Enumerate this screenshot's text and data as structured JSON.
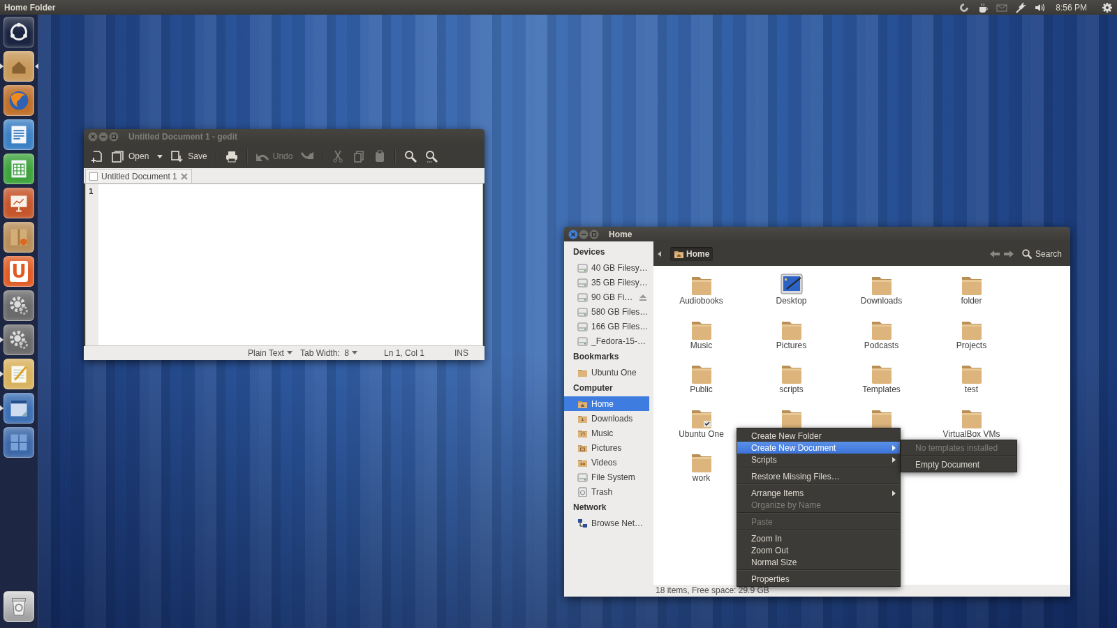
{
  "top_panel": {
    "title": "Home Folder",
    "clock": "8:56 PM"
  },
  "launcher": {
    "items": [
      {
        "kind": "dash",
        "running": false,
        "focused": false
      },
      {
        "kind": "home",
        "running": true,
        "focused": true
      },
      {
        "kind": "browser",
        "running": false,
        "focused": false
      },
      {
        "kind": "writer",
        "running": false,
        "focused": false
      },
      {
        "kind": "calc",
        "running": false,
        "focused": false
      },
      {
        "kind": "impress",
        "running": false,
        "focused": false
      },
      {
        "kind": "package",
        "running": false,
        "focused": false
      },
      {
        "kind": "letter",
        "label": "U",
        "running": false,
        "focused": false
      },
      {
        "kind": "gears",
        "running": false,
        "focused": false
      },
      {
        "kind": "gears",
        "running": true,
        "focused": false
      },
      {
        "kind": "editor",
        "running": true,
        "focused": false
      },
      {
        "kind": "window",
        "running": true,
        "focused": false
      },
      {
        "kind": "workspaces",
        "running": false,
        "focused": false
      }
    ]
  },
  "gedit": {
    "title": "Untitled Document 1 - gedit",
    "toolbar": [
      {
        "kind": "new",
        "disabled": false
      },
      {
        "kind": "open",
        "label": "Open",
        "disabled": false
      },
      {
        "kind": "dropdown",
        "disabled": false
      },
      {
        "kind": "save",
        "label": "Save",
        "disabled": false
      },
      {
        "kind": "separator"
      },
      {
        "kind": "print",
        "disabled": false
      },
      {
        "kind": "separator"
      },
      {
        "kind": "undo",
        "label": "Undo",
        "disabled": true
      },
      {
        "kind": "redo",
        "disabled": true
      },
      {
        "kind": "separator"
      },
      {
        "kind": "cut",
        "disabled": true
      },
      {
        "kind": "copy",
        "disabled": true
      },
      {
        "kind": "paste",
        "disabled": true
      },
      {
        "kind": "separator"
      },
      {
        "kind": "find",
        "disabled": false
      },
      {
        "kind": "replace",
        "disabled": false
      }
    ],
    "tabs": [
      {
        "label": "Untitled Document 1",
        "selected": true
      }
    ],
    "line_numbers": [
      "1"
    ],
    "status": [
      {
        "kind": "dropdown",
        "label": "Plain Text"
      },
      {
        "kind": "dropdown",
        "label": "Tab Width:  8"
      },
      {
        "kind": "text",
        "label": "Ln 1, Col 1"
      },
      {
        "kind": "text",
        "label": "INS"
      }
    ]
  },
  "files": {
    "title": "Home",
    "sidebar": [
      {
        "heading": "Devices",
        "items": [
          {
            "label": "40 GB Filesy…",
            "kind": "drive",
            "selected": false,
            "eject": false
          },
          {
            "label": "35 GB Filesy…",
            "kind": "drive",
            "selected": false,
            "eject": false
          },
          {
            "label": "90 GB Fi…",
            "kind": "drive",
            "selected": false,
            "eject": true
          },
          {
            "label": "580 GB Files…",
            "kind": "drive",
            "selected": false,
            "eject": false
          },
          {
            "label": "166 GB Files…",
            "kind": "drive",
            "selected": false,
            "eject": false
          },
          {
            "label": "_Fedora-15-…",
            "kind": "drive",
            "selected": false,
            "eject": false
          }
        ]
      },
      {
        "heading": "Bookmarks",
        "items": [
          {
            "label": "Ubuntu One",
            "kind": "folder",
            "selected": false,
            "eject": false
          }
        ]
      },
      {
        "heading": "Computer",
        "items": [
          {
            "label": "Home",
            "kind": "home",
            "selected": true,
            "eject": false
          },
          {
            "label": "Downloads",
            "kind": "downloads",
            "selected": false,
            "eject": false
          },
          {
            "label": "Music",
            "kind": "music",
            "selected": false,
            "eject": false
          },
          {
            "label": "Pictures",
            "kind": "pictures",
            "selected": false,
            "eject": false
          },
          {
            "label": "Videos",
            "kind": "videos",
            "selected": false,
            "eject": false
          },
          {
            "label": "File System",
            "kind": "drive",
            "selected": false,
            "eject": false
          },
          {
            "label": "Trash",
            "kind": "trash",
            "selected": false,
            "eject": false
          }
        ]
      },
      {
        "heading": "Network",
        "items": [
          {
            "label": "Browse Net…",
            "kind": "network",
            "selected": false,
            "eject": false
          }
        ]
      }
    ],
    "path": [
      {
        "label": "Home",
        "selected": true
      }
    ],
    "search": "Search",
    "items": [
      {
        "label": "Audiobooks",
        "kind": "folder"
      },
      {
        "label": "Desktop",
        "kind": "desktop"
      },
      {
        "label": "Downloads",
        "kind": "folder"
      },
      {
        "label": "folder",
        "kind": "folder"
      },
      {
        "label": "Music",
        "kind": "folder"
      },
      {
        "label": "Pictures",
        "kind": "folder"
      },
      {
        "label": "Podcasts",
        "kind": "folder"
      },
      {
        "label": "Projects",
        "kind": "folder"
      },
      {
        "label": "Public",
        "kind": "folder"
      },
      {
        "label": "scripts",
        "kind": "folder"
      },
      {
        "label": "Templates",
        "kind": "folder"
      },
      {
        "label": "test",
        "kind": "folder"
      },
      {
        "label": "Ubuntu One",
        "kind": "synced"
      },
      {
        "kind": "folder"
      },
      {
        "kind": "folder"
      },
      {
        "label": "VirtualBox VMs",
        "kind": "folder"
      },
      {
        "label": "work",
        "kind": "folder"
      }
    ],
    "status": "18 items, Free space: 29.9 GB",
    "context_menu": [
      {
        "kind": "item",
        "label": "Create New Folder",
        "selected": false,
        "disabled": false
      },
      {
        "kind": "submenu",
        "label": "Create New Document",
        "selected": true,
        "disabled": false,
        "children": [
          {
            "kind": "item",
            "label": "No templates installed",
            "selected": false,
            "disabled": true
          },
          {
            "kind": "separator"
          },
          {
            "kind": "item",
            "label": "Empty Document",
            "selected": false,
            "disabled": false
          }
        ]
      },
      {
        "kind": "submenu",
        "label": "Scripts",
        "selected": false,
        "disabled": false
      },
      {
        "kind": "separator"
      },
      {
        "kind": "item",
        "label": "Restore Missing Files…",
        "selected": false,
        "disabled": false
      },
      {
        "kind": "separator"
      },
      {
        "kind": "submenu",
        "label": "Arrange Items",
        "selected": false,
        "disabled": false
      },
      {
        "kind": "item",
        "label": "Organize by Name",
        "selected": false,
        "disabled": true
      },
      {
        "kind": "separator"
      },
      {
        "kind": "item",
        "label": "Paste",
        "selected": false,
        "disabled": true
      },
      {
        "kind": "separator"
      },
      {
        "kind": "item",
        "label": "Zoom In",
        "selected": false,
        "disabled": false
      },
      {
        "kind": "item",
        "label": "Zoom Out",
        "selected": false,
        "disabled": false
      },
      {
        "kind": "item",
        "label": "Normal Size",
        "selected": false,
        "disabled": false
      },
      {
        "kind": "separator"
      },
      {
        "kind": "item",
        "label": "Properties",
        "selected": false,
        "disabled": false
      }
    ]
  }
}
